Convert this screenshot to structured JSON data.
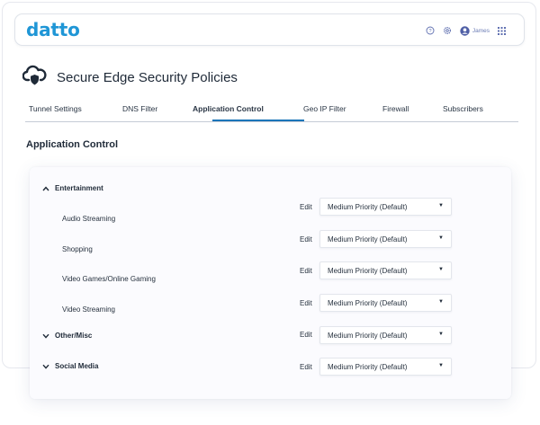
{
  "brand": {
    "logo": "datto"
  },
  "topbar": {
    "user_name": "James",
    "icons": [
      "help-icon",
      "settings-icon",
      "user-icon",
      "apps-grid-icon"
    ]
  },
  "page": {
    "title": "Secure Edge Security Policies",
    "icon": "cloud-shield-icon"
  },
  "tabs": [
    {
      "label": "Tunnel Settings",
      "active": false
    },
    {
      "label": "DNS Filter",
      "active": false
    },
    {
      "label": "Application Control",
      "active": true
    },
    {
      "label": "Geo IP Filter",
      "active": false
    },
    {
      "label": "Firewall",
      "active": false
    },
    {
      "label": "Subscribers",
      "active": false
    }
  ],
  "section": {
    "title": "Application Control"
  },
  "rows": [
    {
      "type": "group",
      "label": "Entertainment",
      "expanded": true
    },
    {
      "type": "item",
      "label": "Audio Streaming",
      "edit": "Edit",
      "priority": "Medium Priority (Default)"
    },
    {
      "type": "item",
      "label": "Shopping",
      "edit": "Edit",
      "priority": "Medium Priority (Default)"
    },
    {
      "type": "item",
      "label": "Video Games/Online Gaming",
      "edit": "Edit",
      "priority": "Medium Priority (Default)"
    },
    {
      "type": "item",
      "label": "Video Streaming",
      "edit": "Edit",
      "priority": "Medium Priority (Default)"
    },
    {
      "type": "group",
      "label": "Other/Misc",
      "expanded": false,
      "edit": "Edit",
      "priority": "Medium Priority (Default)"
    },
    {
      "type": "group",
      "label": "Social Media",
      "expanded": false,
      "edit": "Edit",
      "priority": "Medium Priority (Default)"
    }
  ],
  "colors": {
    "brand": "#1f96d6",
    "tab_accent": "#1b75b9",
    "text": "#1f2a38"
  }
}
